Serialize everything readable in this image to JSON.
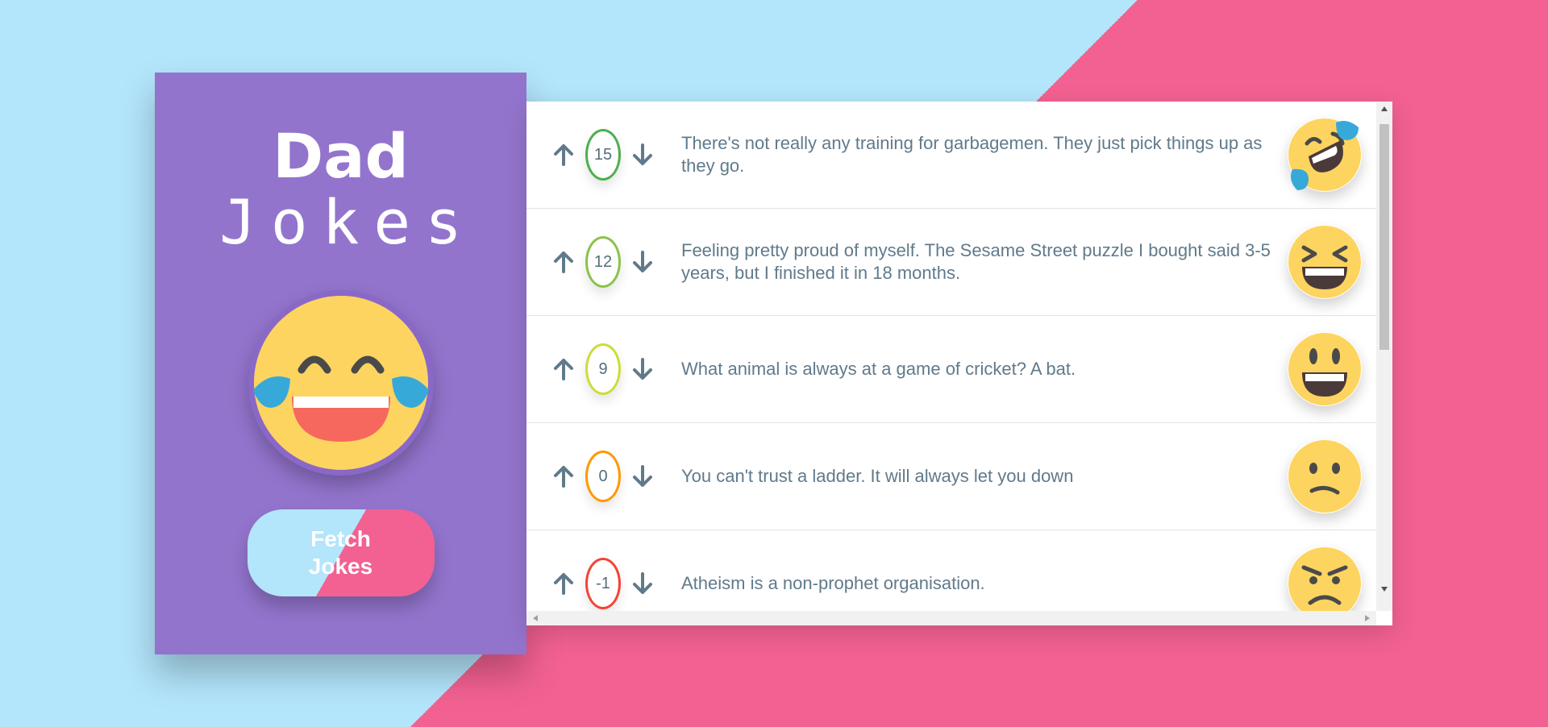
{
  "app": {
    "title_line1": "Dad",
    "title_line2": "Jokes",
    "fetch_button_label": "Fetch Jokes",
    "colors": {
      "sidebar": "#9374cd",
      "background_light": "#b3e5fb",
      "background_pink": "#f26191",
      "text": "#607a8b"
    }
  },
  "jokes": [
    {
      "score": "15",
      "text": "There's not really any training for garbagemen. They just pick things up as they go.",
      "emoji": "rolling-on-floor-laughing",
      "border": "#4caf50"
    },
    {
      "score": "12",
      "text": "Feeling pretty proud of myself. The Sesame Street puzzle I bought said 3-5 years, but I finished it in 18 months.",
      "emoji": "grinning-squinting",
      "border": "#8bc34a"
    },
    {
      "score": "9",
      "text": "What animal is always at a game of cricket? A bat.",
      "emoji": "grinning-big-eyes",
      "border": "#cddc39"
    },
    {
      "score": "0",
      "text": "You can't trust a ladder. It will always let you down",
      "emoji": "confused",
      "border": "#ff9800"
    },
    {
      "score": "-1",
      "text": "Atheism is a non-prophet organisation.",
      "emoji": "angry",
      "border": "#f44336"
    }
  ],
  "icons": {
    "upvote": "arrow-up-icon",
    "downvote": "arrow-down-icon"
  }
}
